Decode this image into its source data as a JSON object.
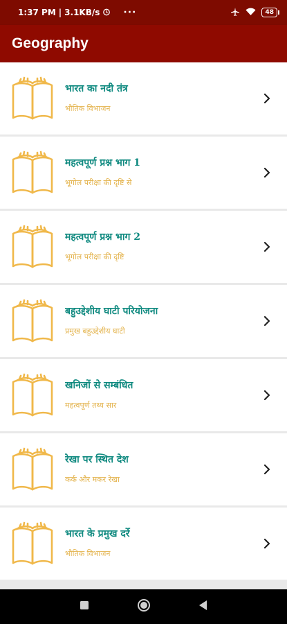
{
  "status_bar": {
    "time": "1:37 PM",
    "speed": "3.1KB/s",
    "dots": "···",
    "battery": "48"
  },
  "app_bar": {
    "title": "Geography"
  },
  "items": [
    {
      "title": "भारत का नदी तंत्र",
      "subtitle": "भौतिक विभाजन"
    },
    {
      "title": "महत्वपूर्ण प्रश्न भाग 1",
      "subtitle": "भूगोल परीक्षा की दृष्टि से"
    },
    {
      "title": "महत्वपूर्ण प्रश्न भाग 2",
      "subtitle": "भूगोल परीक्षा की दृष्टि"
    },
    {
      "title": "बहुउद्देशीय घाटी परियोजना",
      "subtitle": "प्रमुख बहुउद्देशीय घाटी"
    },
    {
      "title": "खनिजों से सम्बंधित",
      "subtitle": "महत्वपूर्ण तथ्य सार"
    },
    {
      "title": "रेखा पर स्थित देश",
      "subtitle": "कर्क और मकर रेखा"
    },
    {
      "title": "भारत के प्रमुख दर्रे",
      "subtitle": "भौतिक विभाजन"
    }
  ],
  "colors": {
    "app_bar": "#8f0a00",
    "status_bar": "#7e0b00",
    "title_text": "#108a80",
    "subtitle_text": "#e3b24a",
    "book_icon": "#f0b84a"
  },
  "icons": {
    "item_icon": "open-book-icon",
    "item_action": "chevron-right-icon",
    "nav": [
      "square-recent-icon",
      "circle-home-icon",
      "triangle-back-icon"
    ]
  }
}
